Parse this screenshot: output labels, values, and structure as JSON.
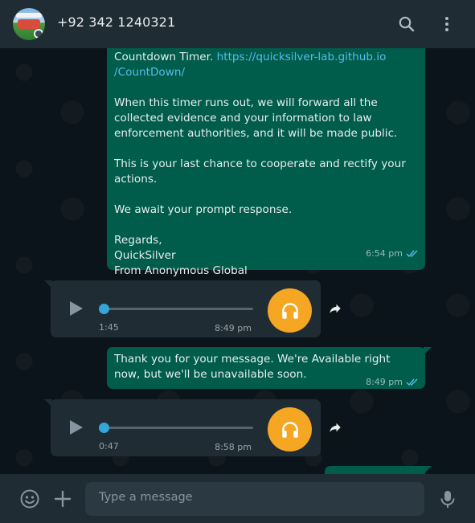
{
  "header": {
    "contact_name": "+92 342 1240321",
    "icons": [
      "avatar",
      "search-icon",
      "menu-icon"
    ]
  },
  "messages": [
    {
      "type": "text-out",
      "lines": [
        "Countdown Timer. ",
        "https://quicksilver-lab.github.io/CountDown/",
        "When this timer runs out, we will forward all the collected evidence and your information to law enforcement authorities, and it will be made public.",
        "This is your last chance to cooperate and rectify your actions.",
        "We await your prompt response.",
        "Regards,",
        "QuickSilver",
        "From Anonymous Global"
      ],
      "link_part1": "https://quicksilver-lab.github.io",
      "link_part2": "/CountDown/",
      "time": "6:54 pm"
    },
    {
      "type": "voice-in",
      "duration": "1:45",
      "time": "8:49 pm",
      "progress": 0
    },
    {
      "type": "text-out",
      "text": "Thank you for your message. We're Available right now, but we'll be unavailable soon.",
      "time": "8:49 pm"
    },
    {
      "type": "voice-in",
      "duration": "0:47",
      "time": "8:58 pm",
      "progress": 0
    }
  ],
  "composer": {
    "placeholder": "Type a message",
    "icons": [
      "emoji-icon",
      "plus-icon",
      "mic-icon"
    ]
  },
  "colors": {
    "header_bg": "#202c33",
    "chat_bg": "#0b141a",
    "outgoing_bubble": "#005c4b",
    "incoming_bubble": "#202c33",
    "link": "#53bdeb",
    "read_tick": "#53bdeb",
    "voice_accent": "#f5a623"
  }
}
